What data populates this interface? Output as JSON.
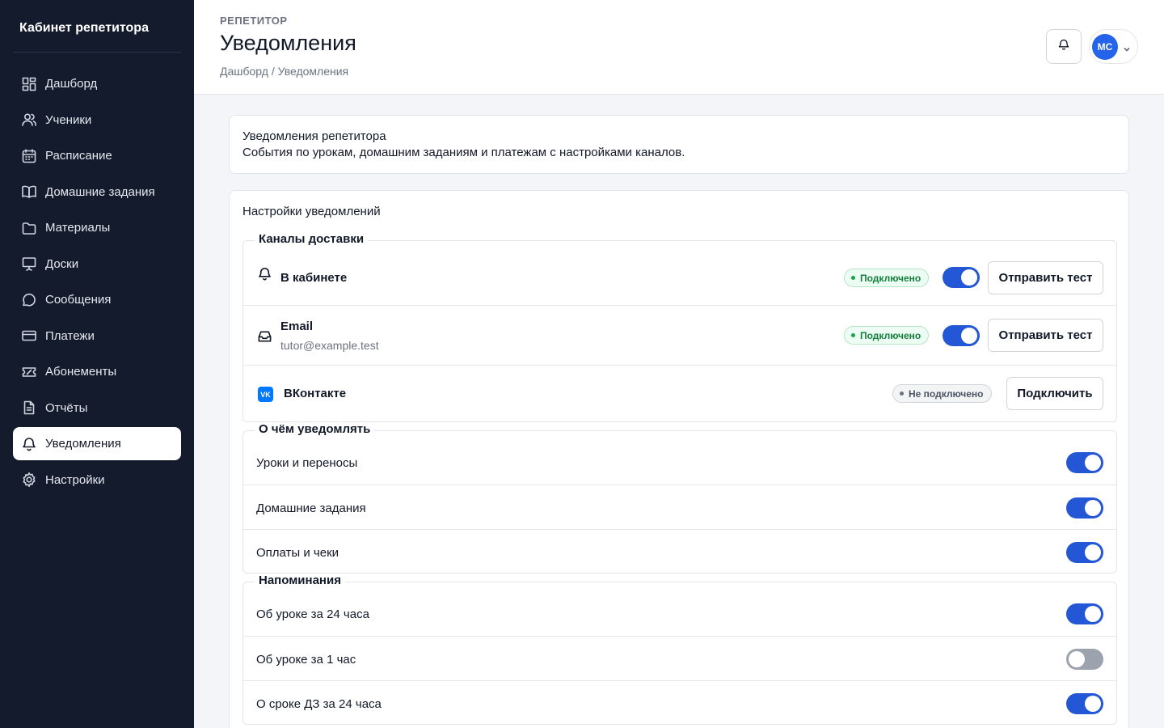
{
  "sidebar": {
    "brand": "Кабинет репетитора",
    "items": [
      {
        "label": "Дашборд",
        "icon": "grid-icon"
      },
      {
        "label": "Ученики",
        "icon": "users-icon"
      },
      {
        "label": "Расписание",
        "icon": "calendar-icon"
      },
      {
        "label": "Домашние задания",
        "icon": "book-icon"
      },
      {
        "label": "Материалы",
        "icon": "folder-icon"
      },
      {
        "label": "Доски",
        "icon": "whiteboard-icon"
      },
      {
        "label": "Сообщения",
        "icon": "message-icon"
      },
      {
        "label": "Платежи",
        "icon": "card-icon"
      },
      {
        "label": "Абонементы",
        "icon": "ticket-icon"
      },
      {
        "label": "Отчёты",
        "icon": "report-icon"
      },
      {
        "label": "Уведомления",
        "icon": "bell-icon",
        "active": true
      },
      {
        "label": "Настройки",
        "icon": "gear-icon"
      }
    ]
  },
  "header": {
    "eyebrow": "РЕПЕТИТОР",
    "title": "Уведомления",
    "breadcrumb": "Дашборд / Уведомления",
    "avatar_initials": "МС"
  },
  "info": {
    "title": "Уведомления репетитора",
    "description": "События по урокам, домашним заданиям и платежам с настройками каналов."
  },
  "settings": {
    "title": "Настройки уведомлений",
    "channels": {
      "legend": "Каналы доставки",
      "items": [
        {
          "label": "В кабинете",
          "status": "Подключено",
          "enabled": true,
          "action": "Отправить тест"
        },
        {
          "label": "Email",
          "sub": "tutor@example.test",
          "status": "Подключено",
          "enabled": true,
          "action": "Отправить тест"
        },
        {
          "label": "ВКонтакте",
          "status": "Не подключено",
          "action": "Подключить"
        }
      ]
    },
    "topics": {
      "legend": "О чём уведомлять",
      "items": [
        {
          "label": "Уроки и переносы",
          "enabled": true
        },
        {
          "label": "Домашние задания",
          "enabled": true
        },
        {
          "label": "Оплаты и чеки",
          "enabled": true
        }
      ]
    },
    "reminders": {
      "legend": "Напоминания",
      "items": [
        {
          "label": "Об уроке за 24 часа",
          "enabled": true
        },
        {
          "label": "Об уроке за 1 час",
          "enabled": false
        },
        {
          "label": "О сроке ДЗ за 24 часа",
          "enabled": true
        }
      ]
    }
  },
  "colors": {
    "sidebar_bg": "#141b2d",
    "accent": "#2357d6",
    "success": "#16a34a"
  }
}
